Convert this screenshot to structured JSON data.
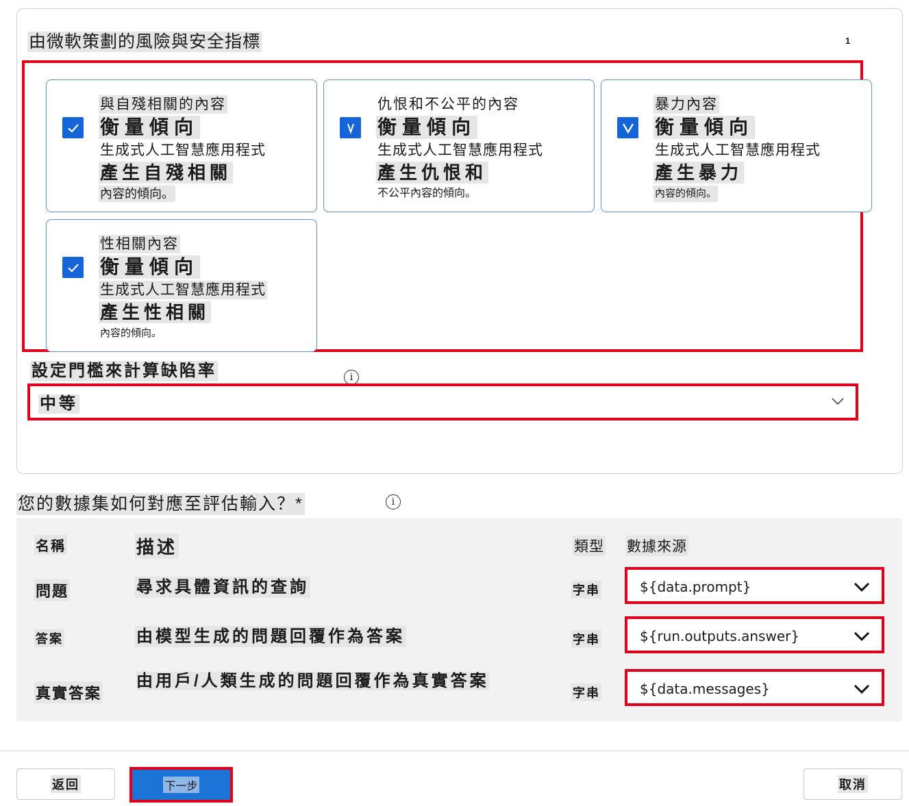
{
  "risk_panel": {
    "title": "由微軟策劃的風險與安全指標",
    "page_marker": "1",
    "metrics": [
      {
        "name": "與自殘相關的內容",
        "checked": true,
        "measure": "衡量傾向",
        "app": "生成式人工智慧應用程式",
        "gen": "產生自殘相關",
        "tail": "內容的傾向。"
      },
      {
        "name": "仇恨和不公平的內容",
        "checked": true,
        "measure": "衡量傾向",
        "app": "生成式人工智慧應用程式",
        "gen": "產生仇恨和",
        "tail": "不公平內容的傾向。"
      },
      {
        "name": "暴力內容",
        "checked": true,
        "measure": "衡量傾向",
        "app": "生成式人工智慧應用程式",
        "gen": "產生暴力",
        "tail": "內容的傾向。"
      },
      {
        "name": "性相關內容",
        "checked": true,
        "measure": "衡量傾向",
        "app": "生成式人工智慧應用程式",
        "gen": "產生性相關",
        "tail": "內容的傾向。"
      }
    ],
    "threshold": {
      "label": "設定門檻來計算缺陷率",
      "info_icon": "info-icon",
      "value": "中等"
    }
  },
  "mapping": {
    "title": "您的數據集如何對應至評估輸入？*",
    "headers": {
      "name": "名稱",
      "description": "描述",
      "type": "類型",
      "source": "數據來源"
    },
    "rows": [
      {
        "name": "問題",
        "description": "尋求具體資訊的查詢",
        "type": "字串",
        "source": "${data.prompt}"
      },
      {
        "name": "答案",
        "description": "由模型生成的問題回覆作為答案",
        "type": "字串",
        "source": "${run.outputs.answer}"
      },
      {
        "name": "真實答案",
        "description": "由用戶/人類生成的問題回覆作為真實答案",
        "type": "字串",
        "source": "${data.messages}"
      }
    ]
  },
  "footer": {
    "back": "返回",
    "next": "下一步",
    "cancel": "取消"
  },
  "colors": {
    "accent": "#1565d8",
    "highlight_red": "#e0001b",
    "card_border": "#5b8ee0"
  }
}
